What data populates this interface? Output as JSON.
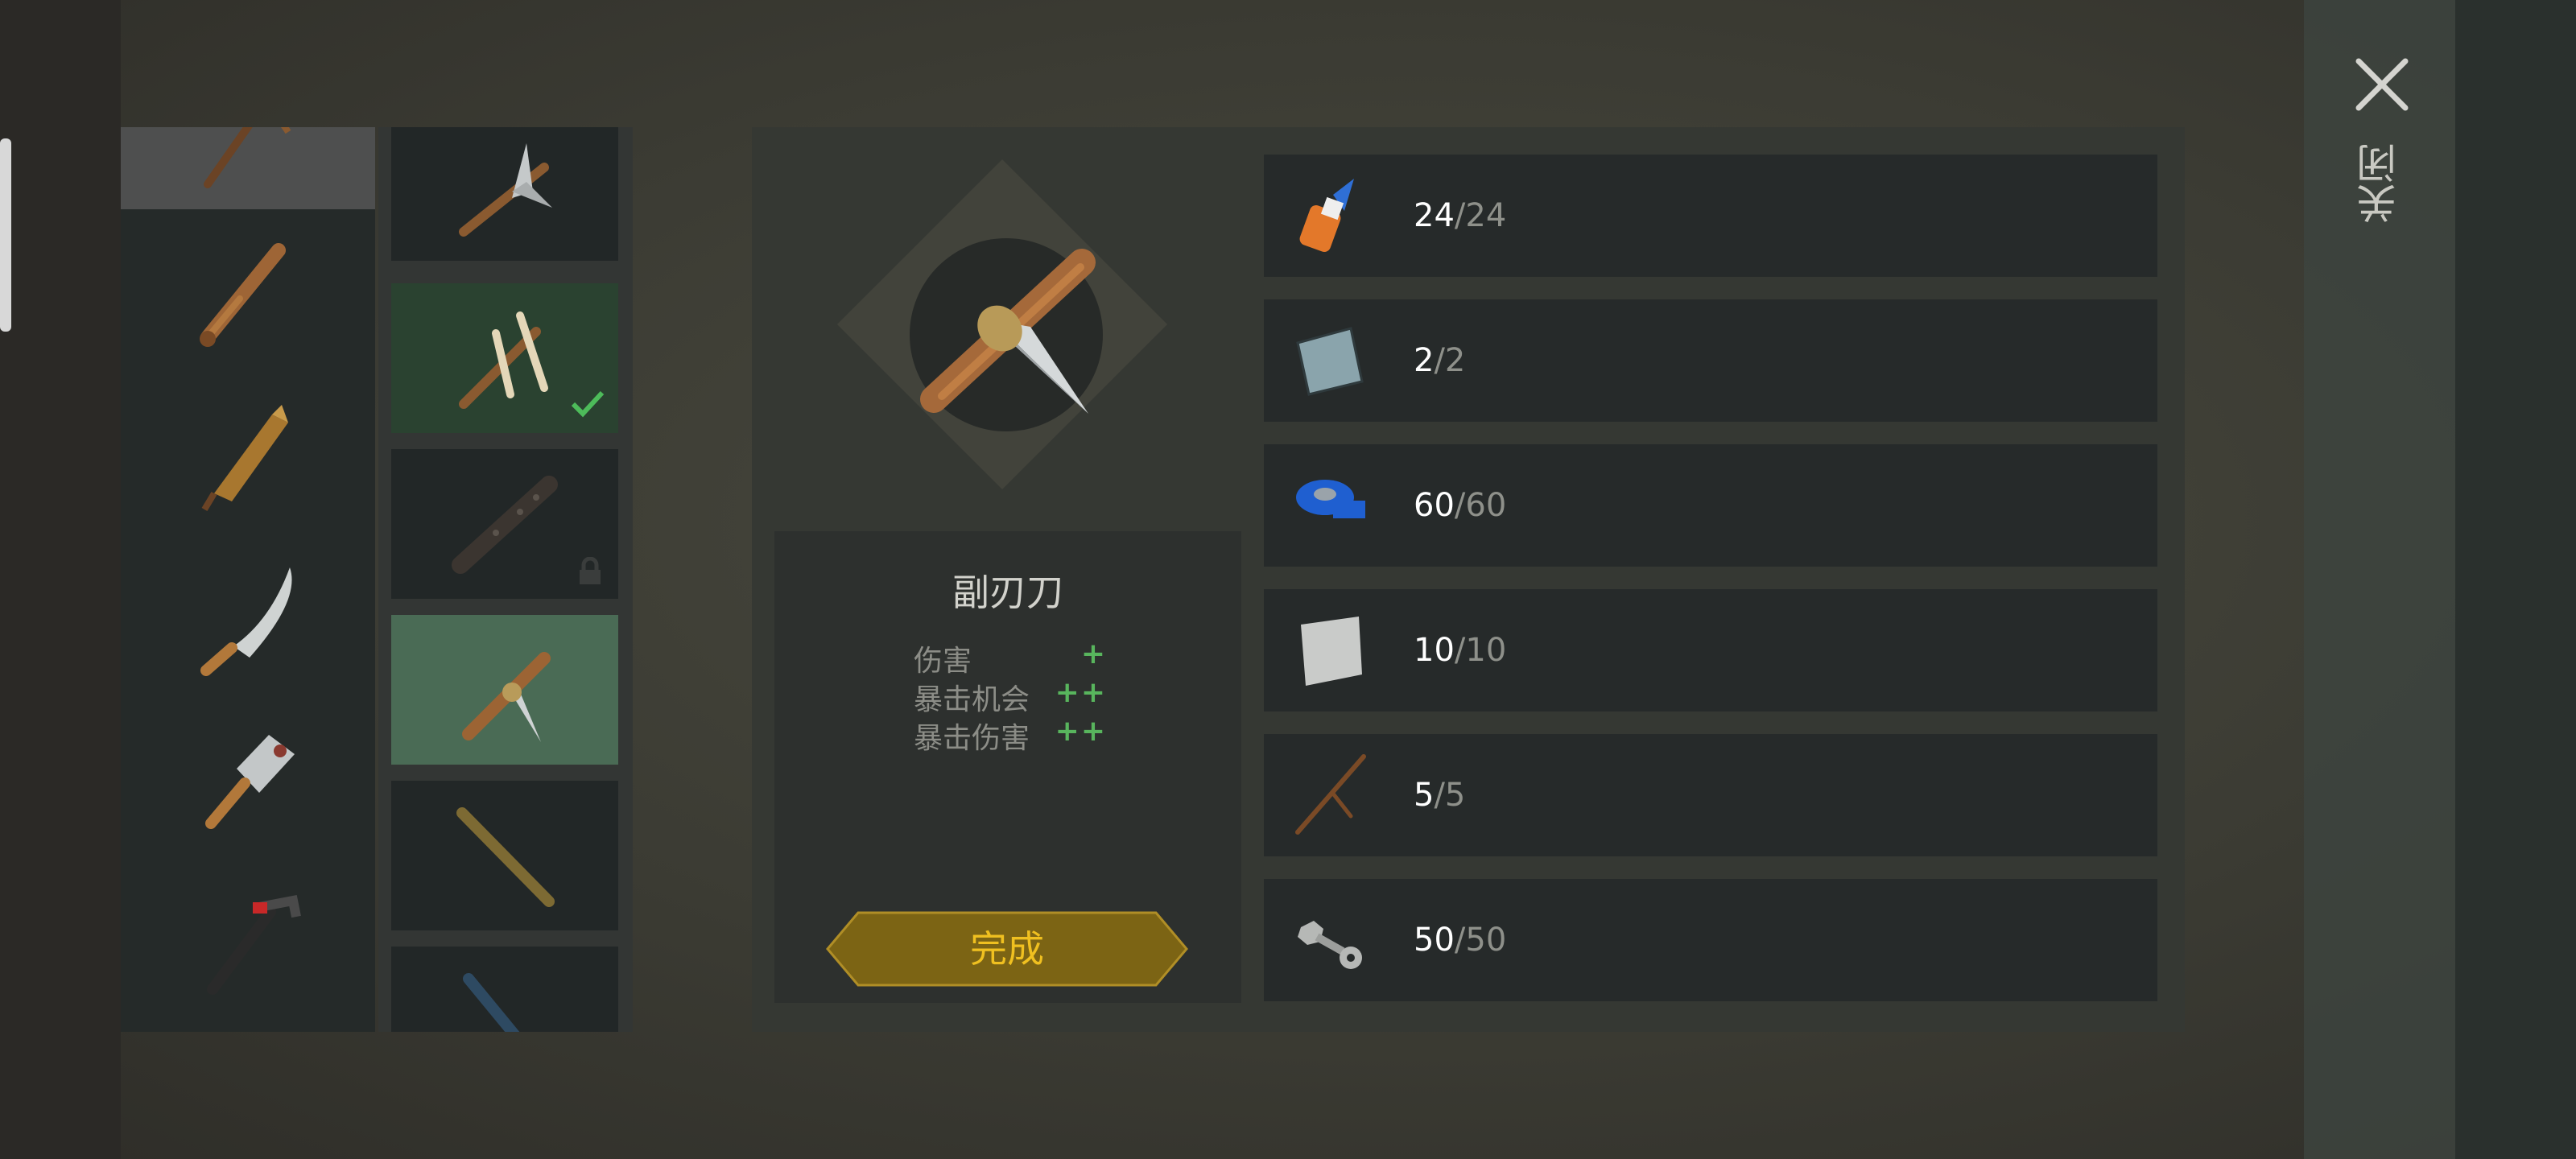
{
  "header": {
    "close_label": "关闭"
  },
  "weapon": {
    "name": "副刃刀",
    "stats": [
      {
        "label": "伤害",
        "value": "+"
      },
      {
        "label": "暴击机会",
        "value": "++"
      },
      {
        "label": "暴击伤害",
        "value": "++"
      }
    ],
    "done_label": "完成"
  },
  "categories": [
    {
      "icon": "pickaxe-icon",
      "selected": true
    },
    {
      "icon": "baseball-bat-icon",
      "selected": false
    },
    {
      "icon": "wooden-plank-icon",
      "selected": false
    },
    {
      "icon": "machete-icon",
      "selected": false
    },
    {
      "icon": "cleaver-icon",
      "selected": false
    },
    {
      "icon": "hammer-pipe-icon",
      "selected": false
    }
  ],
  "variants": [
    {
      "icon": "bladed-stick-icon",
      "state": "normal"
    },
    {
      "icon": "bone-stick-icon",
      "state": "completed"
    },
    {
      "icon": "spiked-club-icon",
      "state": "locked"
    },
    {
      "icon": "stick-knife-icon",
      "state": "selected"
    },
    {
      "icon": "bamboo-stick-icon",
      "state": "normal"
    },
    {
      "icon": "blue-pipe-icon",
      "state": "normal"
    }
  ],
  "materials": [
    {
      "icon": "glue-icon",
      "have": "24",
      "need": "/24"
    },
    {
      "icon": "metal-plate-icon",
      "have": "2",
      "need": "/2"
    },
    {
      "icon": "blue-tape-icon",
      "have": "60",
      "need": "/60"
    },
    {
      "icon": "sheet-metal-icon",
      "have": "10",
      "need": "/10"
    },
    {
      "icon": "wooden-stick-icon",
      "have": "5",
      "need": "/5"
    },
    {
      "icon": "nuts-bolts-icon",
      "have": "50",
      "need": "/50"
    }
  ],
  "colors": {
    "accent_gold": "#f0c020",
    "stat_green": "#58b55d",
    "selected_variant": "#4a6b55"
  }
}
